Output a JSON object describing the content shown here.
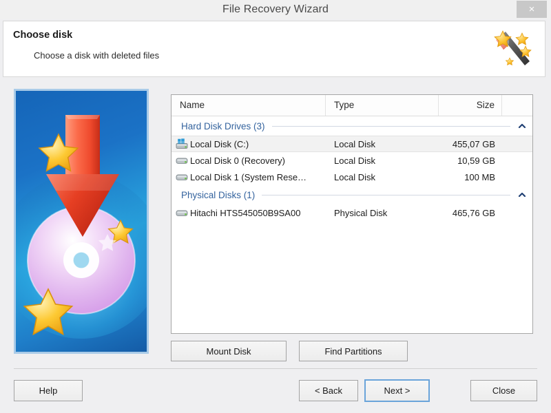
{
  "window": {
    "title": "File Recovery Wizard",
    "close_icon": "close-icon",
    "close_label": "×"
  },
  "header": {
    "title": "Choose disk",
    "subtitle": "Choose a disk with deleted files",
    "icon": "magic-wand-icon"
  },
  "illustration": {
    "icon": "recovery-disc-arrow-illustration"
  },
  "disk_list": {
    "columns": [
      {
        "key": "name",
        "label": "Name",
        "align": "left"
      },
      {
        "key": "type",
        "label": "Type",
        "align": "left"
      },
      {
        "key": "size",
        "label": "Size",
        "align": "right"
      }
    ],
    "groups": [
      {
        "label": "Hard Disk Drives (3)",
        "chevron": "chevron-up-icon",
        "rows": [
          {
            "name": "Local Disk (C:)",
            "type": "Local Disk",
            "size": "455,07 GB",
            "icon": "windows-drive-icon",
            "selected": true
          },
          {
            "name": "Local Disk 0 (Recovery)",
            "type": "Local Disk",
            "size": "10,59 GB",
            "icon": "drive-icon",
            "selected": false
          },
          {
            "name": "Local Disk 1 (System Rese…",
            "type": "Local Disk",
            "size": "100 MB",
            "icon": "drive-icon",
            "selected": false
          }
        ]
      },
      {
        "label": "Physical Disks (1)",
        "chevron": "chevron-up-icon",
        "rows": [
          {
            "name": "Hitachi HTS545050B9SA00",
            "type": "Physical Disk",
            "size": "465,76 GB",
            "icon": "drive-icon",
            "selected": false
          }
        ]
      }
    ]
  },
  "actions": {
    "mount_disk": "Mount Disk",
    "find_partitions": "Find Partitions"
  },
  "footer": {
    "help": "Help",
    "back": "< Back",
    "next": "Next >",
    "close": "Close",
    "default_button": "next"
  },
  "colors": {
    "accent_blue": "#34639e",
    "chevron_blue": "#1f3f73",
    "focus_ring": "#6aa4da",
    "window_bg": "#efeff1",
    "panel_bg": "#ffffff",
    "selected_row": "#f2f2f2",
    "title_text": "#4a4a4a"
  }
}
